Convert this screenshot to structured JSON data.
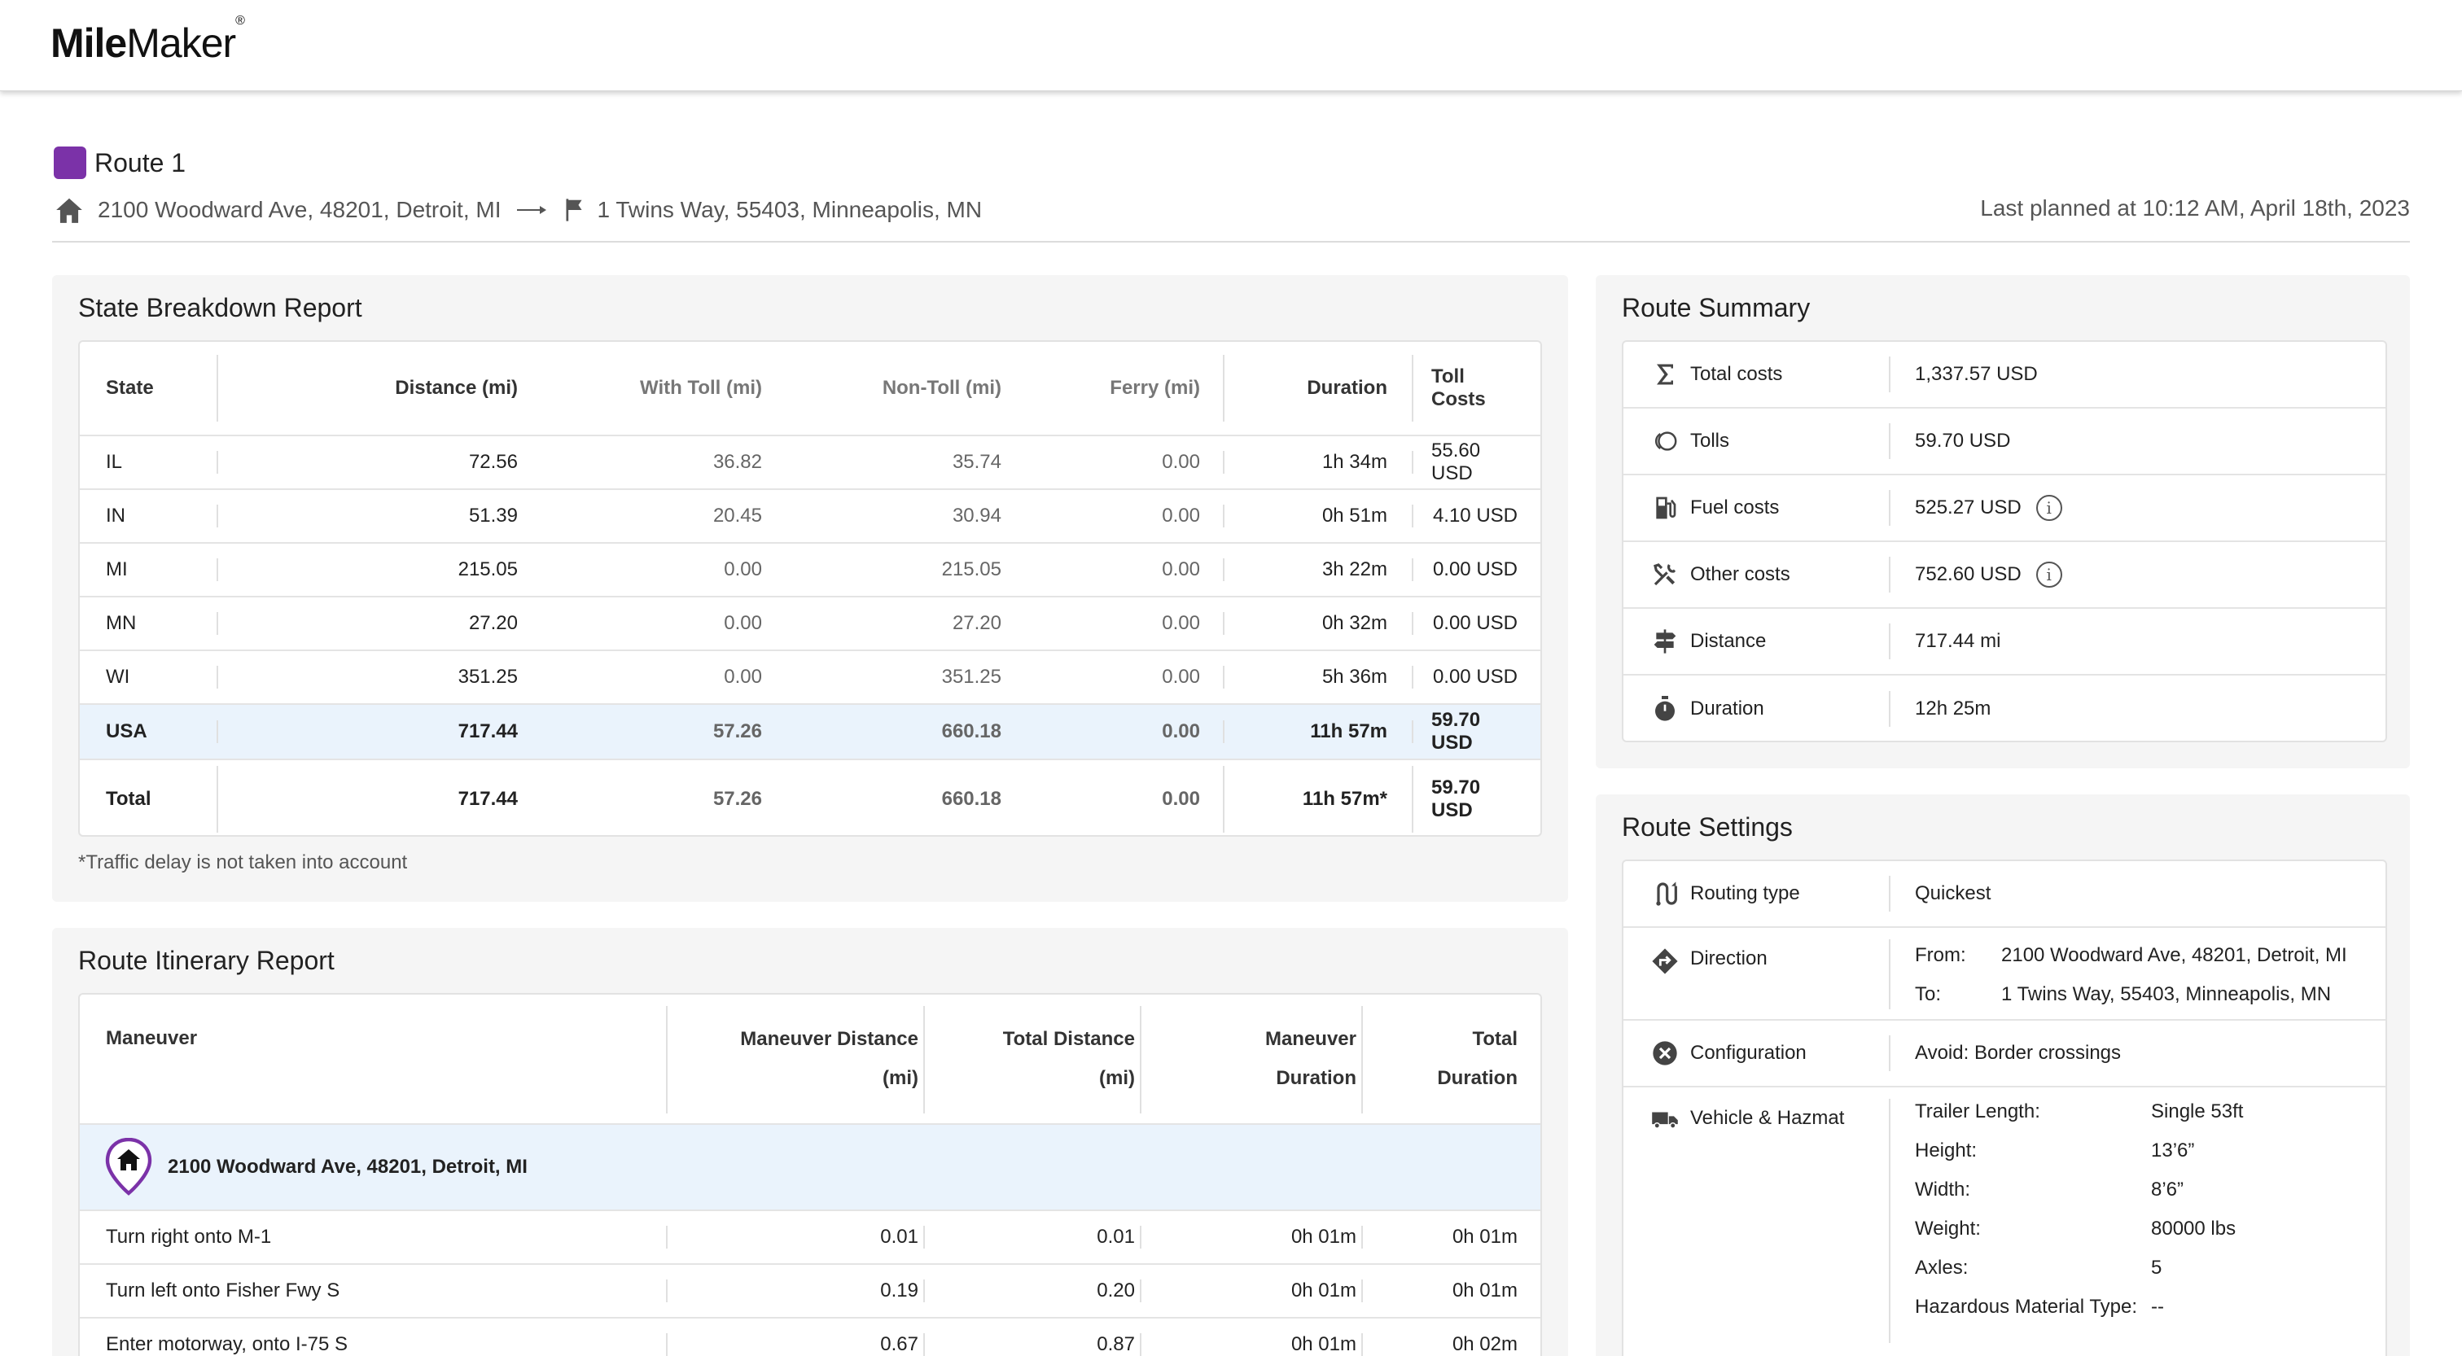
{
  "app": {
    "logo_bold": "Mile",
    "logo_rest": "Maker",
    "logo_mark": "®"
  },
  "route": {
    "name": "Route 1",
    "color": "#7b32a8",
    "origin": "2100 Woodward Ave, 48201, Detroit, MI",
    "destination": "1 Twins Way, 55403, Minneapolis, MN",
    "last_planned": "Last planned at 10:12 AM, April 18th, 2023"
  },
  "state_breakdown": {
    "title": "State Breakdown Report",
    "columns": [
      "State",
      "Distance (mi)",
      "With Toll (mi)",
      "Non-Toll (mi)",
      "Ferry (mi)",
      "Duration",
      "Toll Costs"
    ],
    "rows": [
      [
        "IL",
        "72.56",
        "36.82",
        "35.74",
        "0.00",
        "1h 34m",
        "55.60 USD"
      ],
      [
        "IN",
        "51.39",
        "20.45",
        "30.94",
        "0.00",
        "0h 51m",
        "4.10 USD"
      ],
      [
        "MI",
        "215.05",
        "0.00",
        "215.05",
        "0.00",
        "3h 22m",
        "0.00 USD"
      ],
      [
        "MN",
        "27.20",
        "0.00",
        "27.20",
        "0.00",
        "0h 32m",
        "0.00 USD"
      ],
      [
        "WI",
        "351.25",
        "0.00",
        "351.25",
        "0.00",
        "5h 36m",
        "0.00 USD"
      ]
    ],
    "country_row": [
      "USA",
      "717.44",
      "57.26",
      "660.18",
      "0.00",
      "11h 57m",
      "59.70 USD"
    ],
    "total_row": [
      "Total",
      "717.44",
      "57.26",
      "660.18",
      "0.00",
      "11h 57m*",
      "59.70 USD"
    ],
    "note": "*Traffic delay is not taken into account"
  },
  "itinerary": {
    "title": "Route Itinerary Report",
    "columns": {
      "maneuver": "Maneuver",
      "maneuver_distance": [
        "Maneuver Distance",
        "(mi)"
      ],
      "total_distance": [
        "Total Distance",
        "(mi)"
      ],
      "maneuver_duration": [
        "Maneuver",
        "Duration"
      ],
      "total_duration": [
        "Total",
        "Duration"
      ]
    },
    "start": "2100 Woodward Ave, 48201, Detroit, MI",
    "rows": [
      [
        "Turn right onto M-1",
        "0.01",
        "0.01",
        "0h 01m",
        "0h 01m"
      ],
      [
        "Turn left onto Fisher Fwy S",
        "0.19",
        "0.20",
        "0h 01m",
        "0h 01m"
      ],
      [
        "Enter motorway, onto I-75 S",
        "0.67",
        "0.87",
        "0h 01m",
        "0h 02m"
      ]
    ]
  },
  "summary": {
    "title": "Route Summary",
    "items": [
      {
        "icon": "sigma-icon",
        "label": "Total costs",
        "value": "1,337.57 USD"
      },
      {
        "icon": "toll-coins-icon",
        "label": "Tolls",
        "value": "59.70 USD"
      },
      {
        "icon": "fuel-pump-icon",
        "label": "Fuel costs",
        "value": "525.27 USD"
      },
      {
        "icon": "tools-icon",
        "label": "Other costs",
        "value": "752.60 USD"
      },
      {
        "icon": "signpost-icon",
        "label": "Distance",
        "value": "717.44 mi"
      },
      {
        "icon": "stopwatch-icon",
        "label": "Duration",
        "value": "12h 25m"
      }
    ]
  },
  "settings": {
    "title": "Route Settings",
    "routing_type_label": "Routing type",
    "routing_type": "Quickest",
    "direction_label": "Direction",
    "from_label": "From:",
    "from": "2100 Woodward Ave, 48201, Detroit, MI",
    "to_label": "To:",
    "to": "1 Twins Way, 55403, Minneapolis, MN",
    "configuration_label": "Configuration",
    "configuration": "Avoid: Border crossings",
    "vehicle_label": "Vehicle & Hazmat",
    "vehicle": [
      [
        "Trailer Length:",
        "Single 53ft"
      ],
      [
        "Height:",
        "13’6”"
      ],
      [
        "Width:",
        "8’6”"
      ],
      [
        "Weight:",
        "80000 lbs"
      ],
      [
        "Axles:",
        "5"
      ],
      [
        "Hazardous Material Type:",
        "--"
      ]
    ]
  }
}
